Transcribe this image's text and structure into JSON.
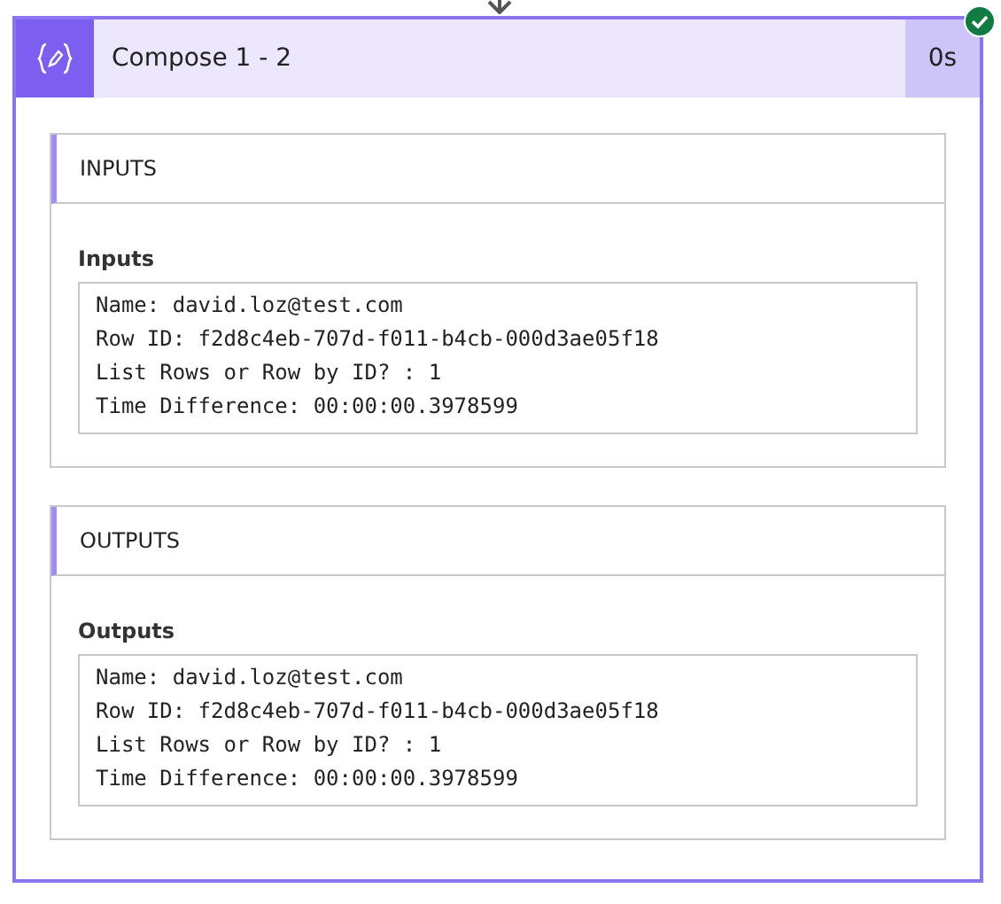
{
  "action": {
    "title": "Compose 1 - 2",
    "duration": "0s",
    "succeeded": true
  },
  "sections": [
    {
      "heading": "INPUTS",
      "label": "Inputs",
      "lines": [
        "Name: david.loz@test.com",
        "Row ID: f2d8c4eb-707d-f011-b4cb-000d3ae05f18",
        "List Rows or Row by ID? : 1",
        "Time Difference: 00:00:00.3978599"
      ]
    },
    {
      "heading": "OUTPUTS",
      "label": "Outputs",
      "lines": [
        "Name: david.loz@test.com",
        "Row ID: f2d8c4eb-707d-f011-b4cb-000d3ae05f18",
        "List Rows or Row by ID? : 1",
        "Time Difference: 00:00:00.3978599"
      ]
    }
  ]
}
